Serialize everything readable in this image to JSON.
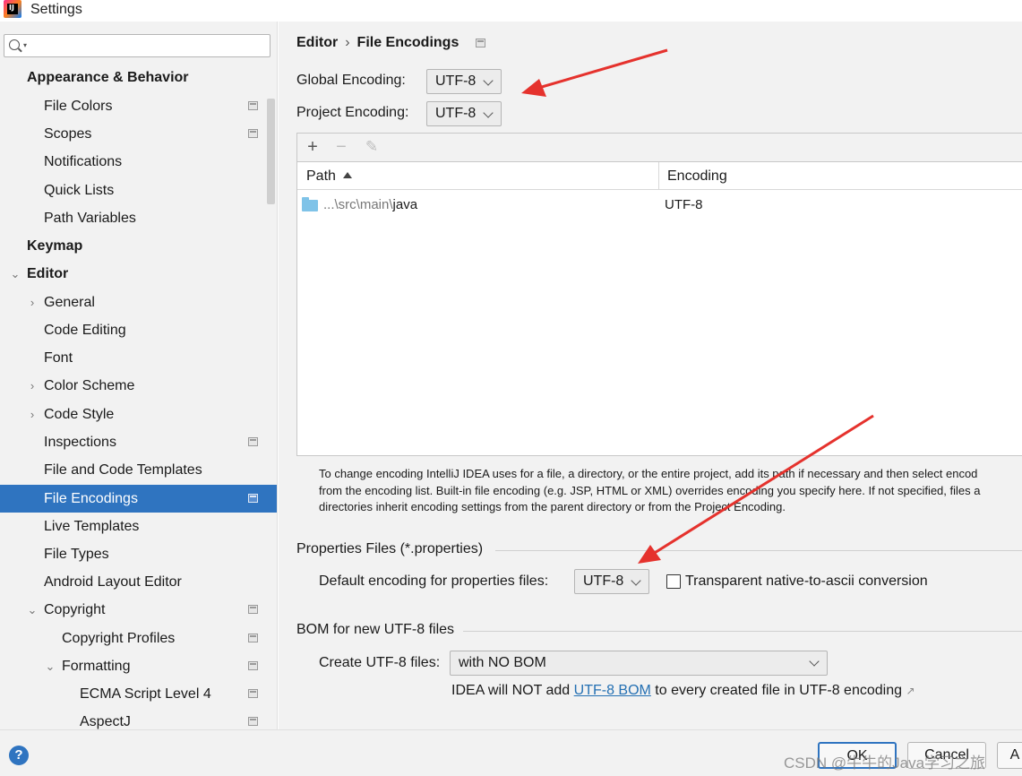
{
  "window": {
    "title": "Settings",
    "app_icon_letters": "IJ"
  },
  "search": {
    "placeholder": ""
  },
  "sidebar": {
    "items": [
      {
        "label": "Appearance & Behavior"
      },
      {
        "label": "File Colors"
      },
      {
        "label": "Scopes"
      },
      {
        "label": "Notifications"
      },
      {
        "label": "Quick Lists"
      },
      {
        "label": "Path Variables"
      },
      {
        "label": "Keymap"
      },
      {
        "label": "Editor"
      },
      {
        "label": "General"
      },
      {
        "label": "Code Editing"
      },
      {
        "label": "Font"
      },
      {
        "label": "Color Scheme"
      },
      {
        "label": "Code Style"
      },
      {
        "label": "Inspections"
      },
      {
        "label": "File and Code Templates"
      },
      {
        "label": "File Encodings"
      },
      {
        "label": "Live Templates"
      },
      {
        "label": "File Types"
      },
      {
        "label": "Android Layout Editor"
      },
      {
        "label": "Copyright"
      },
      {
        "label": "Copyright Profiles"
      },
      {
        "label": "Formatting"
      },
      {
        "label": "ECMA Script Level 4"
      },
      {
        "label": "AspectJ"
      }
    ],
    "selected": "File Encodings"
  },
  "breadcrumb": {
    "parent": "Editor",
    "separator": "›",
    "current": "File Encodings"
  },
  "global_encoding": {
    "label": "Global Encoding:",
    "value": "UTF-8"
  },
  "project_encoding": {
    "label": "Project Encoding:",
    "value": "UTF-8"
  },
  "table": {
    "toolbar": {
      "add": "+",
      "remove": "−",
      "edit": "✎"
    },
    "columns": [
      "Path",
      "Encoding"
    ],
    "rows": [
      {
        "path_prefix": "...\\src\\main\\",
        "path_last": "java",
        "encoding": "UTF-8"
      }
    ]
  },
  "description": {
    "lines": [
      "To change encoding IntelliJ IDEA uses for a file, a directory, or the entire project, add its path if necessary and then select encod",
      "from the encoding list. Built-in file encoding (e.g. JSP, HTML or XML) overrides encoding you specify here. If not specified, files a",
      "directories inherit encoding settings from the parent directory or from the Project Encoding."
    ]
  },
  "properties_section": {
    "title": "Properties Files (*.properties)",
    "default_label": "Default encoding for properties files:",
    "default_value": "UTF-8",
    "transparent_label": "Transparent native-to-ascii conversion",
    "transparent_checked": false
  },
  "bom_section": {
    "title": "BOM for new UTF-8 files",
    "create_label": "Create UTF-8 files:",
    "create_value": "with NO BOM",
    "note_before": "IDEA will NOT add ",
    "note_link": "UTF-8 BOM",
    "note_after": " to every created file in UTF-8 encoding",
    "note_ext_icon": "↗"
  },
  "buttons": {
    "help": "?",
    "ok": "OK",
    "cancel": "Cancel",
    "apply": "A"
  },
  "watermark": "CSDN @牛牛的Java学习之旅",
  "colors": {
    "selection": "#2f74c0",
    "link": "#2470b3",
    "annotation_arrow": "#e5322d"
  }
}
